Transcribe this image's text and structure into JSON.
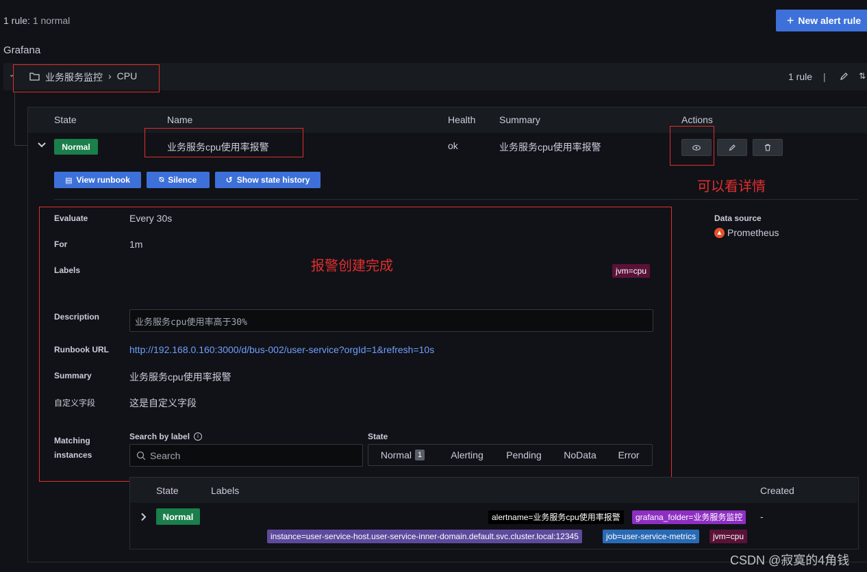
{
  "header": {
    "rule_count_prefix": "1 rule:",
    "rule_count_state": "1 normal",
    "new_rule_label": "New alert rule",
    "datasource_group": "Grafana"
  },
  "folder": {
    "name": "业务服务监控",
    "separator": "›",
    "group": "CPU",
    "rule_count": "1 rule",
    "divider": "|"
  },
  "table": {
    "headers": {
      "state": "State",
      "name": "Name",
      "health": "Health",
      "summary": "Summary",
      "actions": "Actions"
    },
    "row": {
      "state": "Normal",
      "name": "业务服务cpu使用率报警",
      "health": "ok",
      "summary": "业务服务cpu使用率报警"
    }
  },
  "row_buttons": {
    "runbook": "View runbook",
    "silence": "Silence",
    "history": "Show state history"
  },
  "details": {
    "evaluate_label": "Evaluate",
    "evaluate_value": "Every 30s",
    "for_label": "For",
    "for_value": "1m",
    "labels_label": "Labels",
    "labels_tag": "jvm=cpu",
    "description_label": "Description",
    "description_value": "业务服务cpu使用率高于30%",
    "runbook_label": "Runbook URL",
    "runbook_value": "http://192.168.0.160:3000/d/bus-002/user-service?orgId=1&refresh=10s",
    "summary_label": "Summary",
    "summary_value": "业务服务cpu使用率报警",
    "custom_label": "自定义字段",
    "custom_value": "这是自定义字段",
    "datasource_label": "Data source",
    "datasource_value": "Prometheus"
  },
  "instances": {
    "label_line1": "Matching",
    "label_line2": "instances",
    "search_label": "Search by label",
    "search_placeholder": "Search",
    "state_label": "State",
    "states": [
      "Normal",
      "Alerting",
      "Pending",
      "NoData",
      "Error"
    ],
    "normal_count": "1",
    "headers": {
      "state": "State",
      "labels": "Labels",
      "created": "Created"
    },
    "row": {
      "state": "Normal",
      "created": "-",
      "tags": [
        "alertname=业务服务cpu使用率报警",
        "grafana_folder=业务服务监控",
        "instance=user-service-host.user-service-inner-domain.default.svc.cluster.local:12345",
        "job=user-service-metrics",
        "jvm=cpu"
      ]
    }
  },
  "annotations": {
    "view_details": "可以看详情",
    "alert_created": "报警创建完成"
  },
  "watermark": "CSDN @寂寞的4角钱",
  "colors": {
    "accent": "#3d71d9",
    "normal": "#1a7f4b",
    "annotation": "#e02f2f"
  }
}
